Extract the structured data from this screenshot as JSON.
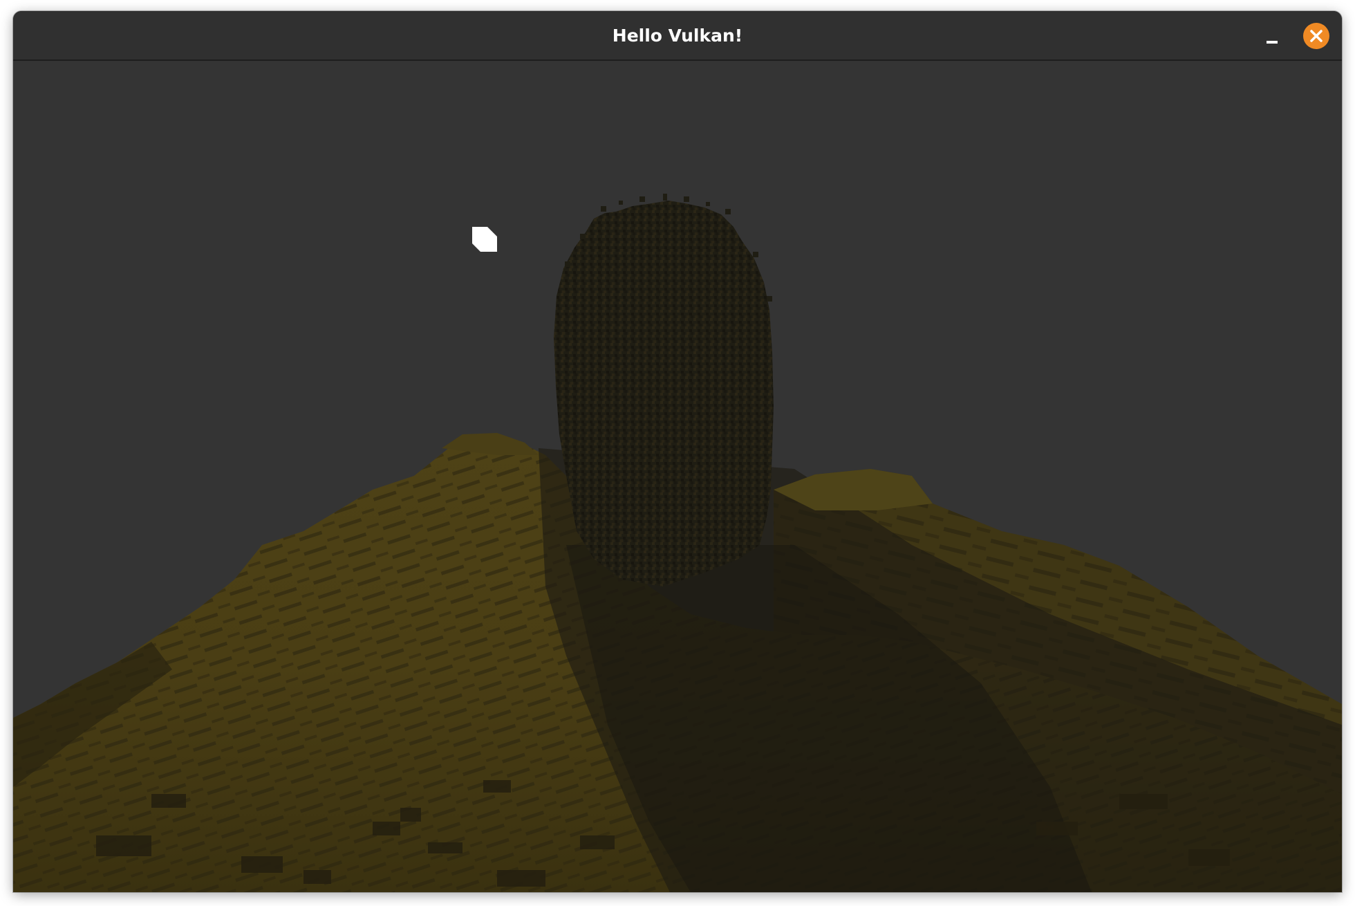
{
  "window": {
    "title": "Hello Vulkan!"
  },
  "titlebar": {
    "minimize_icon": "minimize-icon",
    "close_icon": "close-icon"
  },
  "scene": {
    "sky_color": "#343434",
    "terrain_color": "#5a4a16",
    "terrain_shadow_color": "#2a2410",
    "pillar_color": "#1f1d14"
  },
  "colors": {
    "close_button": "#f08a24",
    "titlebar_bg": "#303030",
    "title_text": "#ffffff"
  }
}
